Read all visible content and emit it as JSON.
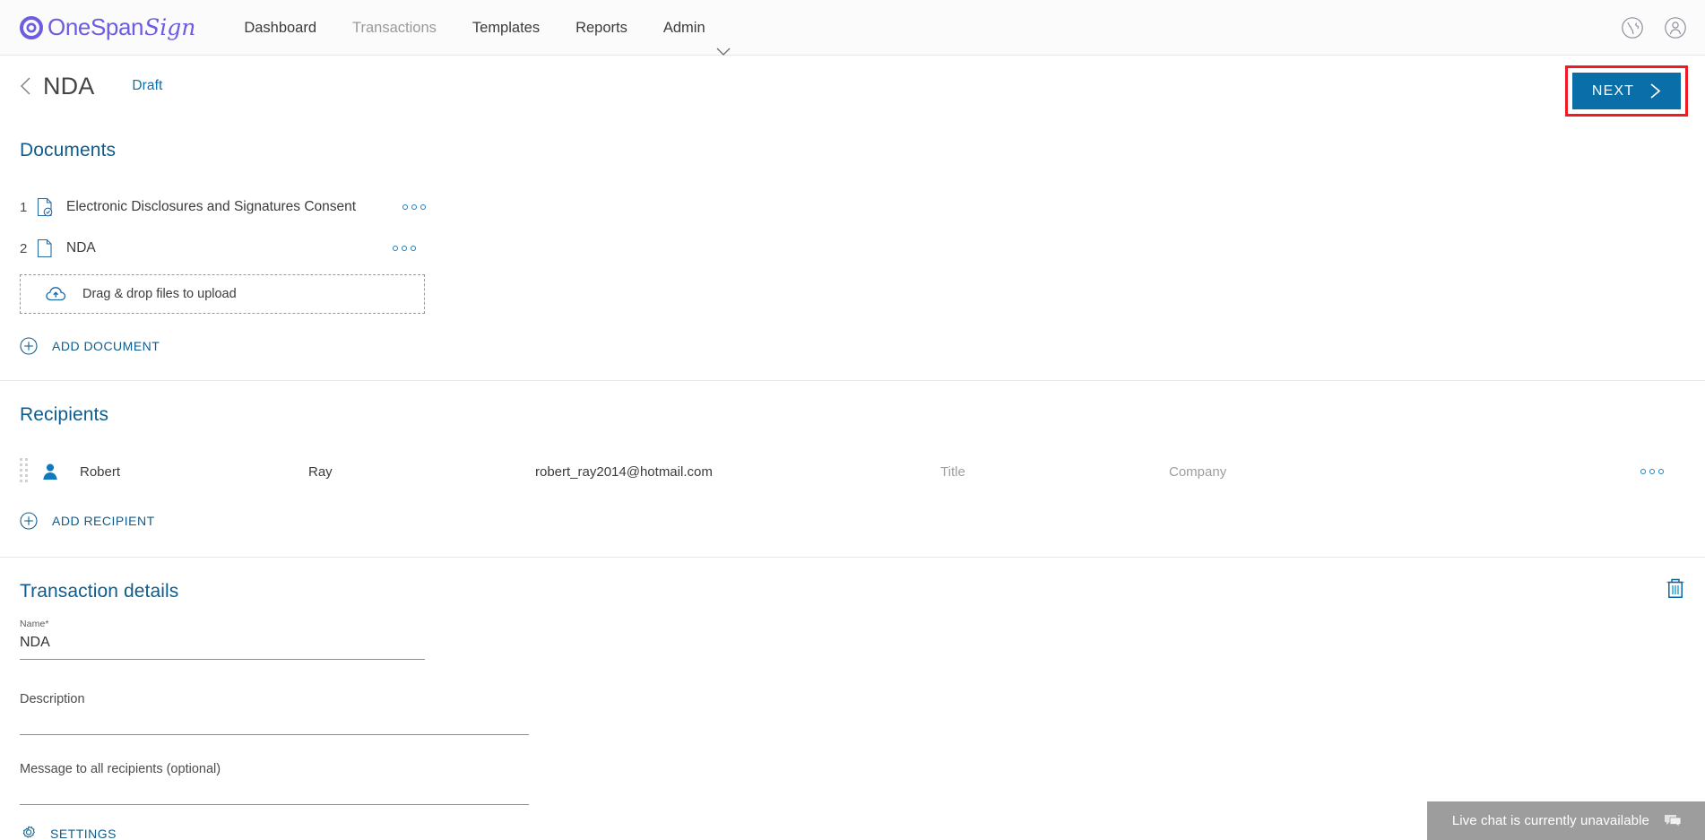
{
  "header": {
    "brand": {
      "name_main": "OneSpan",
      "name_script": "Sign",
      "logo_icon": "onespan-ring-icon",
      "color": "#6C5CE0"
    },
    "nav": [
      {
        "label": "Dashboard",
        "active": true
      },
      {
        "label": "Transactions",
        "active": false
      },
      {
        "label": "Templates",
        "active": true
      },
      {
        "label": "Reports",
        "active": true
      },
      {
        "label": "Admin",
        "active": true,
        "caret": true
      }
    ],
    "right_icons": [
      {
        "name": "globe-language-icon"
      },
      {
        "name": "user-account-icon"
      }
    ]
  },
  "titlebar": {
    "back_icon": "chevron-left-icon",
    "title": "NDA",
    "status": "Draft",
    "next_label": "NEXT",
    "next_icon": "chevron-right-icon",
    "next_bg": "#0a6ea8",
    "highlight_color": "#ee1b24"
  },
  "documents": {
    "heading": "Documents",
    "rows": [
      {
        "number": "1",
        "name": "Electronic Disclosures and Signatures Consent",
        "icon": "document-check-icon",
        "menu_icon": "more-options-icon"
      },
      {
        "number": "2",
        "name": "NDA",
        "icon": "document-icon",
        "menu_icon": "more-options-icon"
      }
    ],
    "dropzone": {
      "label": "Drag & drop files to upload",
      "icon": "cloud-upload-icon"
    },
    "add_label": "ADD DOCUMENT",
    "add_icon": "plus-circle-icon"
  },
  "recipients": {
    "heading": "Recipients",
    "rows": [
      {
        "drag_icon": "drag-handle-icon",
        "avatar_icon": "person-icon",
        "first_name": "Robert",
        "last_name": "Ray",
        "email": "robert_ray2014@hotmail.com",
        "title_placeholder": "Title",
        "company_placeholder": "Company",
        "menu_icon": "more-options-icon"
      }
    ],
    "add_label": "ADD RECIPIENT",
    "add_icon": "plus-circle-icon"
  },
  "details": {
    "heading": "Transaction details",
    "delete_icon": "trash-icon",
    "name_label": "Name",
    "name_required_mark": "*",
    "name_value": "NDA",
    "description_placeholder": "Description",
    "message_placeholder": "Message to all recipients (optional)",
    "settings_label": "SETTINGS",
    "settings_icon": "gear-icon"
  },
  "livechat": {
    "text": "Live chat is currently unavailable",
    "icon": "chat-bubble-icon",
    "bg": "#9d9d9d"
  }
}
